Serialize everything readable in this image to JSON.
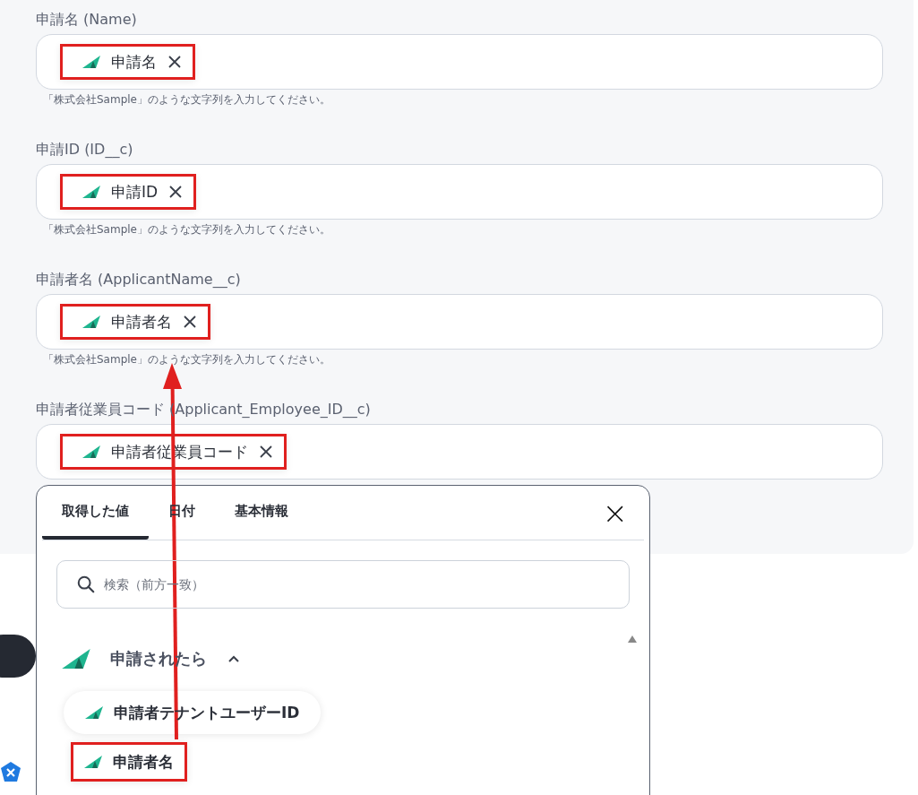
{
  "fields": [
    {
      "label": "申請名 (Name)",
      "chip": {
        "text": "申請名",
        "highlighted": true
      },
      "hint": "「株式会社Sample」のような文字列を入力してください。"
    },
    {
      "label": "申請ID (ID__c)",
      "chip": {
        "text": "申請ID",
        "highlighted": true
      },
      "hint": "「株式会社Sample」のような文字列を入力してください。"
    },
    {
      "label": "申請者名 (ApplicantName__c)",
      "chip": {
        "text": "申請者名",
        "highlighted": true
      },
      "hint": "「株式会社Sample」のような文字列を入力してください。"
    },
    {
      "label": "申請者従業員コード (Applicant_Employee_ID__c)",
      "chip": {
        "text": "申請者従業員コード",
        "highlighted": true
      }
    }
  ],
  "popup": {
    "tabs": [
      {
        "label": "取得した値",
        "selected": true
      },
      {
        "label": "日付",
        "selected": false
      },
      {
        "label": "基本情報",
        "selected": false
      }
    ],
    "close": "×",
    "search": {
      "placeholder": "検索（前方一致）"
    },
    "group": {
      "title": "申請されたら",
      "expanded": true,
      "items": [
        {
          "text": "申請者テナントユーザーID",
          "highlighted": false
        },
        {
          "text": "申請者名",
          "highlighted": true
        }
      ]
    }
  }
}
